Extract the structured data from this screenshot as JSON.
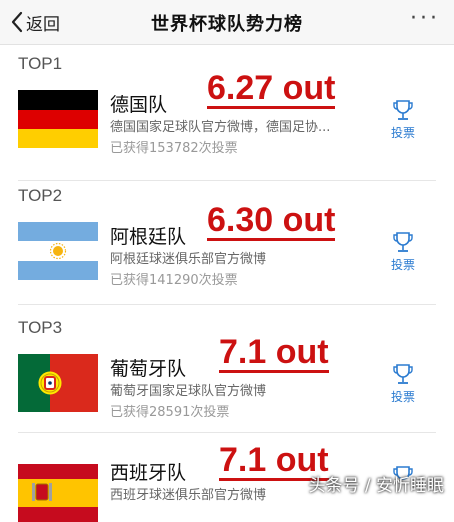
{
  "header": {
    "back_label": "返回",
    "title": "世界杯球队势力榜",
    "more_label": "···"
  },
  "teams": [
    {
      "rank": "TOP1",
      "name": "德国队",
      "desc": "德国国家足球队官方微博，德国足协...",
      "votes": "已获得153782次投票",
      "odds": "6.27 out",
      "flag": "germany",
      "vote_label": "投票"
    },
    {
      "rank": "TOP2",
      "name": "阿根廷队",
      "desc": "阿根廷球迷俱乐部官方微博",
      "votes": "已获得141290次投票",
      "odds": "6.30 out",
      "flag": "argentina",
      "vote_label": "投票"
    },
    {
      "rank": "TOP3",
      "name": "葡萄牙队",
      "desc": "葡萄牙国家足球队官方微博",
      "votes": "已获得28591次投票",
      "odds": "7.1 out",
      "flag": "portugal",
      "vote_label": "投票"
    },
    {
      "rank": "",
      "name": "西班牙队",
      "desc": "西班牙球迷俱乐部官方微博",
      "votes": "",
      "odds": "7.1 out",
      "flag": "spain",
      "vote_label": ""
    }
  ],
  "watermark": "头条号 / 安忻睡眠",
  "colors": {
    "odds_red": "#cc1111",
    "vote_blue": "#2b7bd0",
    "header_bg": "#f7f7f7"
  },
  "icons": {
    "back": "chevron-left-icon",
    "more": "more-dots-icon",
    "vote": "trophy-icon"
  }
}
